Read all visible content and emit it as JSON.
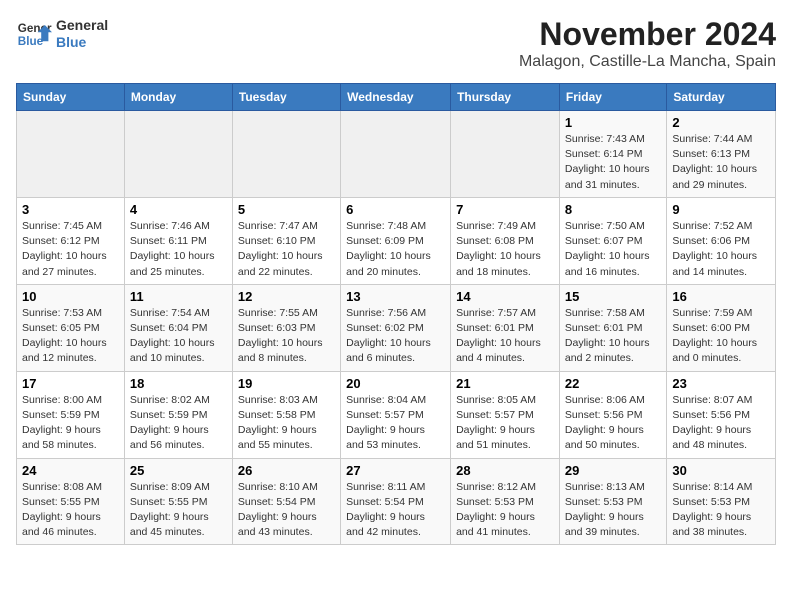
{
  "header": {
    "logo_line1": "General",
    "logo_line2": "Blue",
    "month": "November 2024",
    "location": "Malagon, Castille-La Mancha, Spain"
  },
  "weekdays": [
    "Sunday",
    "Monday",
    "Tuesday",
    "Wednesday",
    "Thursday",
    "Friday",
    "Saturday"
  ],
  "weeks": [
    [
      {
        "day": "",
        "info": ""
      },
      {
        "day": "",
        "info": ""
      },
      {
        "day": "",
        "info": ""
      },
      {
        "day": "",
        "info": ""
      },
      {
        "day": "",
        "info": ""
      },
      {
        "day": "1",
        "info": "Sunrise: 7:43 AM\nSunset: 6:14 PM\nDaylight: 10 hours\nand 31 minutes."
      },
      {
        "day": "2",
        "info": "Sunrise: 7:44 AM\nSunset: 6:13 PM\nDaylight: 10 hours\nand 29 minutes."
      }
    ],
    [
      {
        "day": "3",
        "info": "Sunrise: 7:45 AM\nSunset: 6:12 PM\nDaylight: 10 hours\nand 27 minutes."
      },
      {
        "day": "4",
        "info": "Sunrise: 7:46 AM\nSunset: 6:11 PM\nDaylight: 10 hours\nand 25 minutes."
      },
      {
        "day": "5",
        "info": "Sunrise: 7:47 AM\nSunset: 6:10 PM\nDaylight: 10 hours\nand 22 minutes."
      },
      {
        "day": "6",
        "info": "Sunrise: 7:48 AM\nSunset: 6:09 PM\nDaylight: 10 hours\nand 20 minutes."
      },
      {
        "day": "7",
        "info": "Sunrise: 7:49 AM\nSunset: 6:08 PM\nDaylight: 10 hours\nand 18 minutes."
      },
      {
        "day": "8",
        "info": "Sunrise: 7:50 AM\nSunset: 6:07 PM\nDaylight: 10 hours\nand 16 minutes."
      },
      {
        "day": "9",
        "info": "Sunrise: 7:52 AM\nSunset: 6:06 PM\nDaylight: 10 hours\nand 14 minutes."
      }
    ],
    [
      {
        "day": "10",
        "info": "Sunrise: 7:53 AM\nSunset: 6:05 PM\nDaylight: 10 hours\nand 12 minutes."
      },
      {
        "day": "11",
        "info": "Sunrise: 7:54 AM\nSunset: 6:04 PM\nDaylight: 10 hours\nand 10 minutes."
      },
      {
        "day": "12",
        "info": "Sunrise: 7:55 AM\nSunset: 6:03 PM\nDaylight: 10 hours\nand 8 minutes."
      },
      {
        "day": "13",
        "info": "Sunrise: 7:56 AM\nSunset: 6:02 PM\nDaylight: 10 hours\nand 6 minutes."
      },
      {
        "day": "14",
        "info": "Sunrise: 7:57 AM\nSunset: 6:01 PM\nDaylight: 10 hours\nand 4 minutes."
      },
      {
        "day": "15",
        "info": "Sunrise: 7:58 AM\nSunset: 6:01 PM\nDaylight: 10 hours\nand 2 minutes."
      },
      {
        "day": "16",
        "info": "Sunrise: 7:59 AM\nSunset: 6:00 PM\nDaylight: 10 hours\nand 0 minutes."
      }
    ],
    [
      {
        "day": "17",
        "info": "Sunrise: 8:00 AM\nSunset: 5:59 PM\nDaylight: 9 hours\nand 58 minutes."
      },
      {
        "day": "18",
        "info": "Sunrise: 8:02 AM\nSunset: 5:59 PM\nDaylight: 9 hours\nand 56 minutes."
      },
      {
        "day": "19",
        "info": "Sunrise: 8:03 AM\nSunset: 5:58 PM\nDaylight: 9 hours\nand 55 minutes."
      },
      {
        "day": "20",
        "info": "Sunrise: 8:04 AM\nSunset: 5:57 PM\nDaylight: 9 hours\nand 53 minutes."
      },
      {
        "day": "21",
        "info": "Sunrise: 8:05 AM\nSunset: 5:57 PM\nDaylight: 9 hours\nand 51 minutes."
      },
      {
        "day": "22",
        "info": "Sunrise: 8:06 AM\nSunset: 5:56 PM\nDaylight: 9 hours\nand 50 minutes."
      },
      {
        "day": "23",
        "info": "Sunrise: 8:07 AM\nSunset: 5:56 PM\nDaylight: 9 hours\nand 48 minutes."
      }
    ],
    [
      {
        "day": "24",
        "info": "Sunrise: 8:08 AM\nSunset: 5:55 PM\nDaylight: 9 hours\nand 46 minutes."
      },
      {
        "day": "25",
        "info": "Sunrise: 8:09 AM\nSunset: 5:55 PM\nDaylight: 9 hours\nand 45 minutes."
      },
      {
        "day": "26",
        "info": "Sunrise: 8:10 AM\nSunset: 5:54 PM\nDaylight: 9 hours\nand 43 minutes."
      },
      {
        "day": "27",
        "info": "Sunrise: 8:11 AM\nSunset: 5:54 PM\nDaylight: 9 hours\nand 42 minutes."
      },
      {
        "day": "28",
        "info": "Sunrise: 8:12 AM\nSunset: 5:53 PM\nDaylight: 9 hours\nand 41 minutes."
      },
      {
        "day": "29",
        "info": "Sunrise: 8:13 AM\nSunset: 5:53 PM\nDaylight: 9 hours\nand 39 minutes."
      },
      {
        "day": "30",
        "info": "Sunrise: 8:14 AM\nSunset: 5:53 PM\nDaylight: 9 hours\nand 38 minutes."
      }
    ]
  ]
}
